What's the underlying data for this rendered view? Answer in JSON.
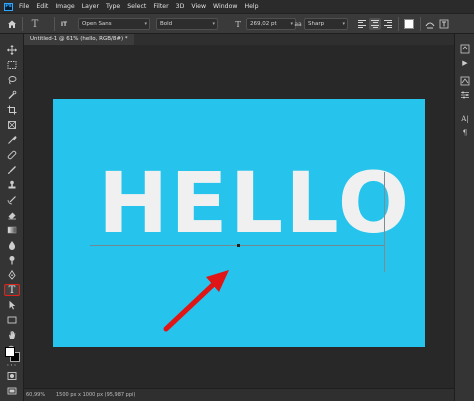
{
  "app": {
    "logo": "Ps"
  },
  "menu": [
    "File",
    "Edit",
    "Image",
    "Layer",
    "Type",
    "Select",
    "Filter",
    "3D",
    "View",
    "Window",
    "Help"
  ],
  "options": {
    "font_family": "Open Sans",
    "font_style": "Bold",
    "font_size": "269,02 pt",
    "antialias": "Sharp",
    "orientation_glyph": "IT",
    "font_size_glyph": "T",
    "aa_glyph": "aa",
    "text_color": "#ffffff"
  },
  "document": {
    "tab_title": "Untitled-1 @ 61% (hello, RGB/8#) *",
    "canvas_text": "HELLO",
    "canvas_color": "#26c4ec",
    "text_color": "#f0f0f0"
  },
  "status": {
    "zoom": "60,99%",
    "info": "1500 px x 1000 px (95,987 ppi)",
    "arrow": "›"
  },
  "toolbar": {
    "active_tool": "type-tool",
    "active_glyph": "T",
    "highlight_color": "#e0231b"
  },
  "annotation": {
    "arrow_color": "#e01515"
  }
}
